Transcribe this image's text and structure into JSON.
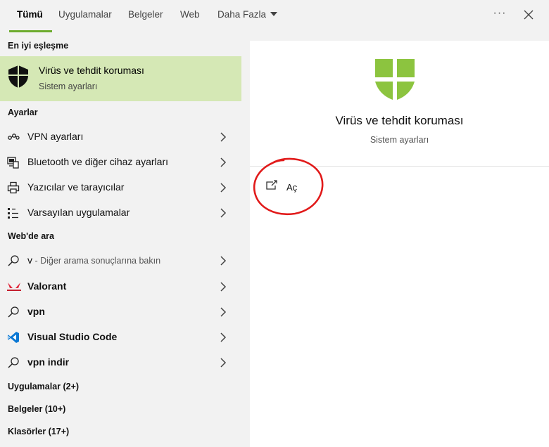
{
  "tabs": [
    {
      "label": "Tümü",
      "active": true
    },
    {
      "label": "Uygulamalar"
    },
    {
      "label": "Belgeler"
    },
    {
      "label": "Web"
    },
    {
      "label": "Daha Fazla"
    }
  ],
  "more_glyph": "···",
  "left": {
    "best_match_title": "En iyi eşleşme",
    "best_match": {
      "name": "Virüs ve tehdit koruması",
      "sub": "Sistem ayarları",
      "icon": "shield-icon"
    },
    "settings_title": "Ayarlar",
    "settings": [
      {
        "label": "VPN ayarları",
        "icon": "vpn-icon"
      },
      {
        "label": "Bluetooth ve diğer cihaz ayarları",
        "icon": "devices-icon"
      },
      {
        "label": "Yazıcılar ve tarayıcılar",
        "icon": "printer-icon"
      },
      {
        "label": "Varsayılan uygulamalar",
        "icon": "default-apps-icon"
      }
    ],
    "web_title": "Web'de ara",
    "web": [
      {
        "label": "v",
        "sub": " - Diğer arama sonuçlarına bakın",
        "icon": "search-icon"
      },
      {
        "label": "Valorant",
        "icon": "valorant-icon"
      },
      {
        "label": "vpn",
        "icon": "search-icon"
      },
      {
        "label": "Visual Studio Code",
        "icon": "vscode-icon"
      },
      {
        "label": "vpn indir",
        "icon": "search-icon"
      }
    ],
    "apps_title": "Uygulamalar (2+)",
    "docs_title": "Belgeler (10+)",
    "folders_title": "Klasörler (17+)"
  },
  "right": {
    "title": "Virüs ve tehdit koruması",
    "subtitle": "Sistem ayarları",
    "open_label": "Aç"
  },
  "colors": {
    "accent": "#6dab2e",
    "best_bg": "#d5e8b5",
    "shield_green": "#8cc43f",
    "annotation": "#e11a1a"
  }
}
